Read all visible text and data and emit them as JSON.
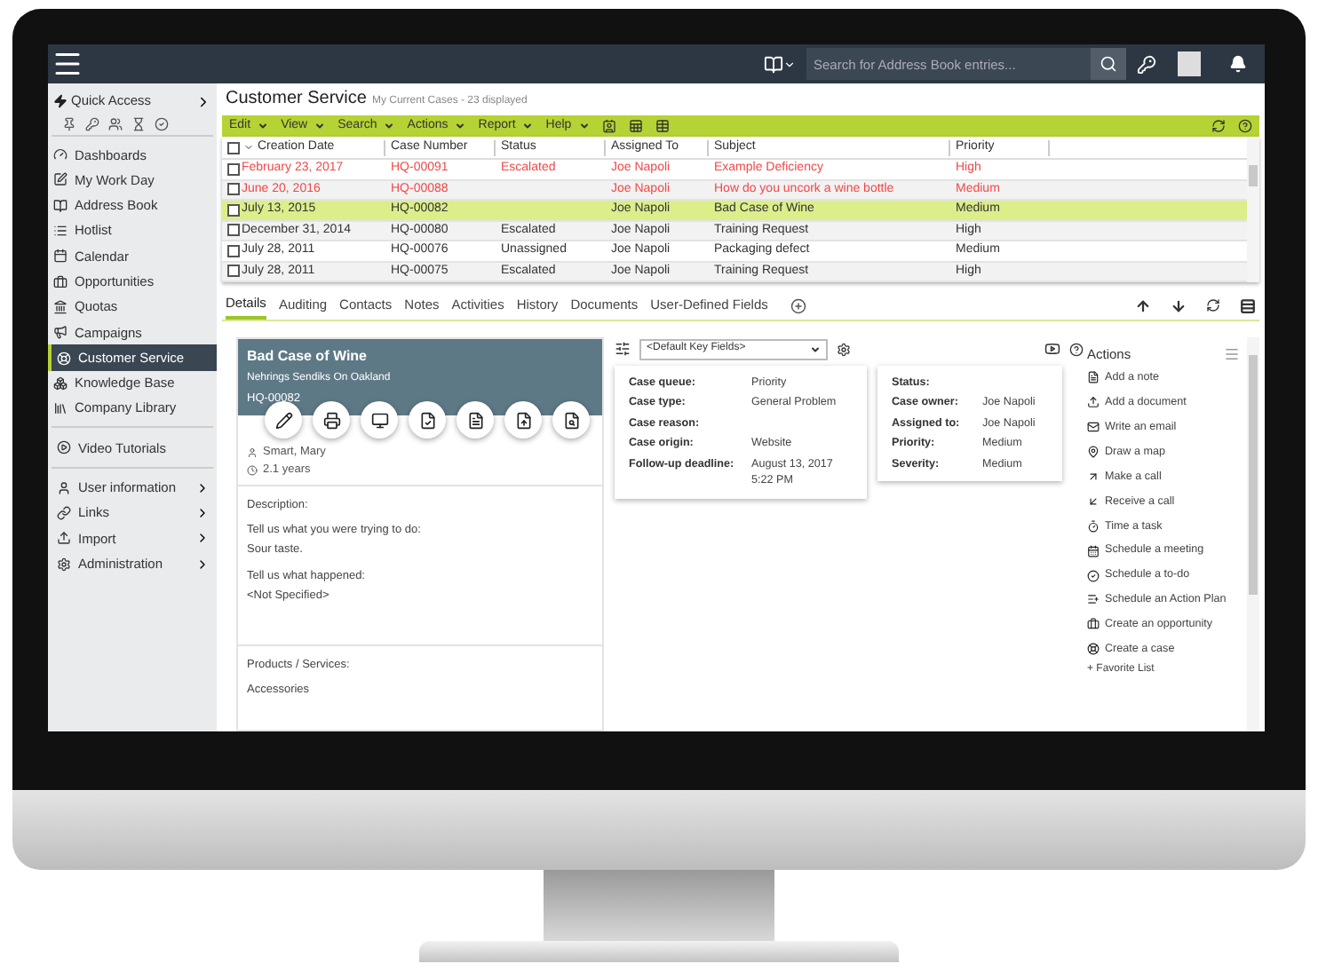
{
  "top_bar": {
    "search_placeholder": "Search for Address Book entries..."
  },
  "sidebar": {
    "quick_access": "Quick Access",
    "sections": [
      [
        {
          "label": "Dashboards",
          "selected": false,
          "expandable": false
        },
        {
          "label": "My Work Day",
          "selected": false,
          "expandable": false
        },
        {
          "label": "Address Book",
          "selected": false,
          "expandable": false
        },
        {
          "label": "Hotlist",
          "selected": false,
          "expandable": false
        },
        {
          "label": "Calendar",
          "selected": false,
          "expandable": false
        },
        {
          "label": "Opportunities",
          "selected": false,
          "expandable": false
        },
        {
          "label": "Quotas",
          "selected": false,
          "expandable": false
        },
        {
          "label": "Campaigns",
          "selected": false,
          "expandable": false
        },
        {
          "label": "Customer Service",
          "selected": true,
          "expandable": false
        },
        {
          "label": "Knowledge Base",
          "selected": false,
          "expandable": false
        },
        {
          "label": "Company Library",
          "selected": false,
          "expandable": false
        }
      ],
      [
        {
          "label": "Video Tutorials",
          "selected": false,
          "expandable": false
        }
      ],
      [
        {
          "label": "User information",
          "selected": false,
          "expandable": true
        },
        {
          "label": "Links",
          "selected": false,
          "expandable": true
        },
        {
          "label": "Import",
          "selected": false,
          "expandable": true
        },
        {
          "label": "Administration",
          "selected": false,
          "expandable": true
        }
      ]
    ]
  },
  "header": {
    "title": "Customer Service",
    "subtitle": "My Current Cases - 23 displayed"
  },
  "menu": [
    "Edit",
    "View",
    "Search",
    "Actions",
    "Report",
    "Help"
  ],
  "table": {
    "select_all_checked": false,
    "columns": [
      "Creation Date",
      "Case Number",
      "Status",
      "Assigned To",
      "Subject",
      "Priority"
    ],
    "rows": [
      {
        "selected": false,
        "flagged": true,
        "cells": [
          "February 23, 2017",
          "HQ-00091",
          "Escalated",
          "Joe Napoli",
          "Example Deficiency",
          "High"
        ]
      },
      {
        "selected": false,
        "flagged": true,
        "cells": [
          "June 20, 2016",
          "HQ-00088",
          "",
          "Joe Napoli",
          "How do you uncork a wine bottle",
          "Medium"
        ]
      },
      {
        "selected": true,
        "flagged": false,
        "cells": [
          "July 13, 2015",
          "HQ-00082",
          "",
          "Joe Napoli",
          "Bad Case of Wine",
          "Medium"
        ]
      },
      {
        "selected": false,
        "flagged": false,
        "cells": [
          "December 31, 2014",
          "HQ-00080",
          "Escalated",
          "Joe Napoli",
          "Training Request",
          "High"
        ]
      },
      {
        "selected": false,
        "flagged": false,
        "cells": [
          "July 28, 2011",
          "HQ-00076",
          "Unassigned",
          "Joe Napoli",
          "Packaging defect",
          "Medium"
        ]
      },
      {
        "selected": false,
        "flagged": false,
        "cells": [
          "July 28, 2011",
          "HQ-00075",
          "Escalated",
          "Joe Napoli",
          "Training Request",
          "High"
        ]
      }
    ]
  },
  "tabs": [
    {
      "label": "Details",
      "selected": true
    },
    {
      "label": "Auditing",
      "selected": false
    },
    {
      "label": "Contacts",
      "selected": false
    },
    {
      "label": "Notes",
      "selected": false
    },
    {
      "label": "Activities",
      "selected": false
    },
    {
      "label": "History",
      "selected": false
    },
    {
      "label": "Documents",
      "selected": false
    },
    {
      "label": "User-Defined Fields",
      "selected": false
    }
  ],
  "case_card": {
    "title": "Bad Case of Wine",
    "company": "Nehrings Sendiks On Oakland",
    "number": "HQ-00082",
    "contact": "Smart, Mary",
    "age": "2.1 years",
    "description_label": "Description:",
    "description": [
      [
        "Tell us what you were trying to do:",
        "Sour taste."
      ],
      [
        "Tell us what happened:",
        "<Not Specified>"
      ]
    ],
    "products_label": "Products / Services:",
    "products": "Accessories"
  },
  "key_fields": {
    "dropdown": "<Default Key Fields>",
    "panels": [
      [
        {
          "label": "Case queue:",
          "value": "Priority"
        },
        {
          "label": "Case type:",
          "value": "General Problem"
        },
        {
          "label": "Case reason:"
        },
        {
          "label": "Case origin:",
          "value": "Website"
        },
        {
          "label": "Follow-up deadline:",
          "value": "August 13, 2017\n5:22 PM"
        }
      ],
      [
        {
          "label": "Status:"
        },
        {
          "label": "Case owner:",
          "value": "Joe Napoli"
        },
        {
          "label": "Assigned to:",
          "value": "Joe Napoli"
        },
        {
          "label": "Priority:",
          "value": "Medium"
        },
        {
          "label": "Severity:",
          "value": "Medium"
        }
      ]
    ]
  },
  "actions": {
    "title": "Actions",
    "items": [
      "Add a note",
      "Add a document",
      "Write an email",
      "Draw a map",
      "Make a call",
      "Receive a call",
      "Time a task",
      "Schedule a meeting",
      "Schedule a to-do",
      "Schedule an Action Plan",
      "Create an opportunity",
      "Create a case"
    ],
    "favorite": "+ Favorite List"
  }
}
